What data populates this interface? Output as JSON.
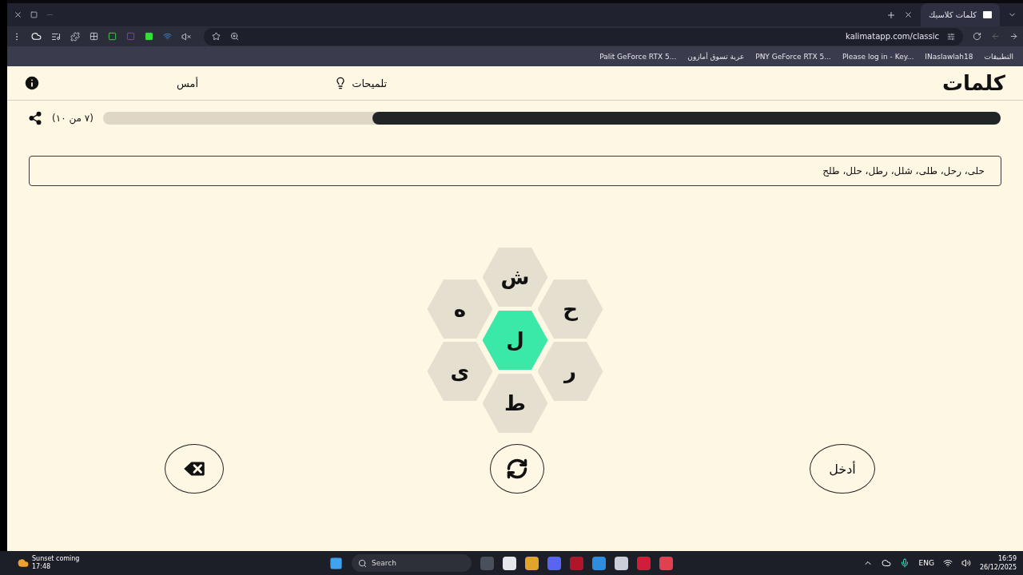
{
  "browser": {
    "tab": {
      "title": "كلمات كلاسيك",
      "selected": true
    },
    "url": "kalimatapp.com/classic",
    "bookmarks": [
      {
        "label": "التطبيقات"
      },
      {
        "label": "INaslawlah18"
      },
      {
        "label": "Please log in - Key..."
      },
      {
        "label": "PNY GeForce RTX 5..."
      },
      {
        "label": "عربة تسوق أمازون"
      },
      {
        "label": "Palit GeForce RTX 5..."
      }
    ]
  },
  "header": {
    "logo": "كلمات",
    "hints": "تلميحات",
    "yesterday": "أمس"
  },
  "progress": {
    "level": 0.7,
    "label": "(٧ من ١٠)"
  },
  "found_words": "حلى، رحل، طلى، شلل، رطل، حلل، طلح",
  "letters": [
    {
      "letter": "ش",
      "kind": "outer"
    },
    {
      "letter": "ح",
      "kind": "outer"
    },
    {
      "letter": "ه",
      "kind": "outer"
    },
    {
      "letter": "ل",
      "kind": "center"
    },
    {
      "letter": "ر",
      "kind": "outer"
    },
    {
      "letter": "ى",
      "kind": "outer"
    },
    {
      "letter": "ط",
      "kind": "outer"
    }
  ],
  "actions": {
    "enter": "أدخل"
  },
  "taskbar": {
    "weather_title": "Sunset coming",
    "weather_time": "17:48",
    "search": "Search",
    "language": "ENG",
    "time": "16:59",
    "date": "26/12/2025"
  }
}
